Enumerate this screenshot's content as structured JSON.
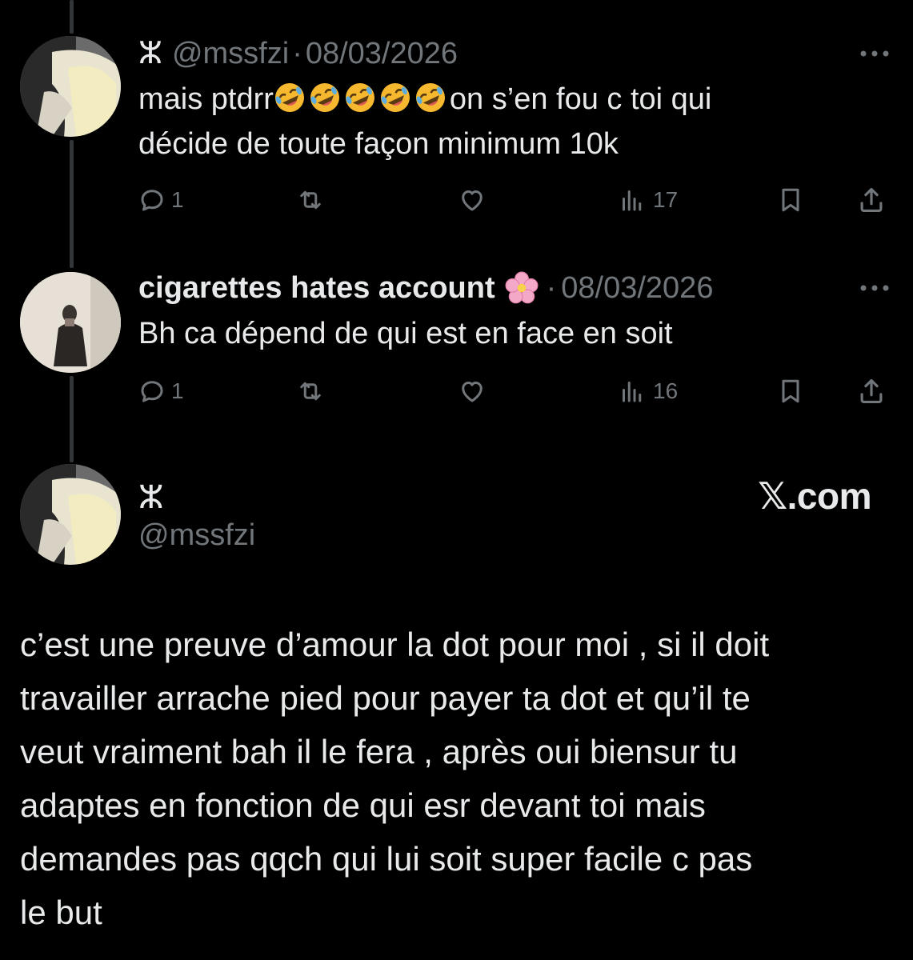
{
  "tweets": [
    {
      "name": "ⵣ",
      "handle": "@mssfzi",
      "separator": "·",
      "date": "08/03/2026",
      "text_line1_a": "mais ptdrr",
      "emojis": [
        "rolling-on-floor-laughing",
        "rolling-on-floor-laughing",
        "rolling-on-floor-laughing",
        "rolling-on-floor-laughing",
        "rolling-on-floor-laughing"
      ],
      "text_line1_b": "on s’en fou c toi qui",
      "text_line2": "décide de toute façon minimum 10k",
      "replies": "1",
      "views": "17"
    },
    {
      "name": "cigarettes hates account",
      "name_emoji": "cherry-blossom",
      "handle": "",
      "separator": "·",
      "date": "08/03/2026",
      "text_line1": "Bh ca dépend de qui est en face en soit",
      "replies": "1",
      "views": "16"
    }
  ],
  "main_post": {
    "name": "ⵣ",
    "handle": "@mssfzi",
    "brand": "𝕏.com",
    "lines": [
      "c’est une preuve d’amour la dot pour moi , si il doit",
      "travailler arrache pied pour payer ta dot et qu’il te",
      "veut vraiment bah il le fera , après oui biensur tu",
      "adaptes en fonction de qui esr devant toi mais",
      "demandes pas qqch qui lui soit super facile c pas",
      "le but"
    ]
  },
  "colors": {
    "background": "#000000",
    "text": "#e7e9ea",
    "secondary": "#71767b",
    "thread_line": "#333639"
  }
}
